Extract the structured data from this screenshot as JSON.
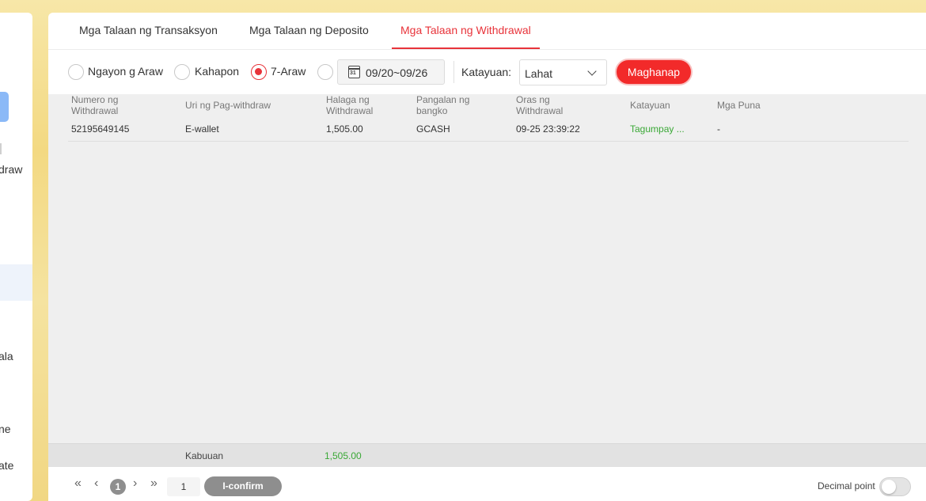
{
  "sidebar": {
    "fragments": [
      "draw",
      "ala",
      "ne",
      "ate"
    ]
  },
  "tabs": [
    {
      "label": "Mga Talaan ng Transaksyon",
      "active": false
    },
    {
      "label": "Mga Talaan ng Deposito",
      "active": false
    },
    {
      "label": "Mga Talaan ng Withdrawal",
      "active": true
    }
  ],
  "filters": {
    "radios": [
      {
        "label": "Ngayon g Araw",
        "checked": false
      },
      {
        "label": "Kahapon",
        "checked": false
      },
      {
        "label": "7-Araw",
        "checked": true
      }
    ],
    "date_range": "09/20~09/26",
    "calendar_day": "31",
    "status_label": "Katayuan:",
    "status_value": "Lahat",
    "search_label": "Maghanap"
  },
  "table": {
    "headers": [
      "Numero ng Withdrawal",
      "Uri ng Pag-withdraw",
      "Halaga ng Withdrawal",
      "Pangalan ng bangko",
      "Oras ng Withdrawal",
      "Katayuan",
      "Mga Puna"
    ],
    "rows": [
      {
        "number": "52195649145",
        "type": "E-wallet",
        "amount": "1,505.00",
        "bank": "GCASH",
        "time": "09-25 23:39:22",
        "status": "Tagumpay ...",
        "remarks": "-"
      }
    ],
    "total_label": "Kabuuan",
    "total_value": "1,505.00"
  },
  "pager": {
    "current_page": "1",
    "page_input": "1",
    "confirm_label": "I-confirm",
    "decimal_label": "Decimal point"
  },
  "colors": {
    "accent": "#e8333a",
    "success": "#3aa836",
    "button_red": "#f22a2a"
  }
}
